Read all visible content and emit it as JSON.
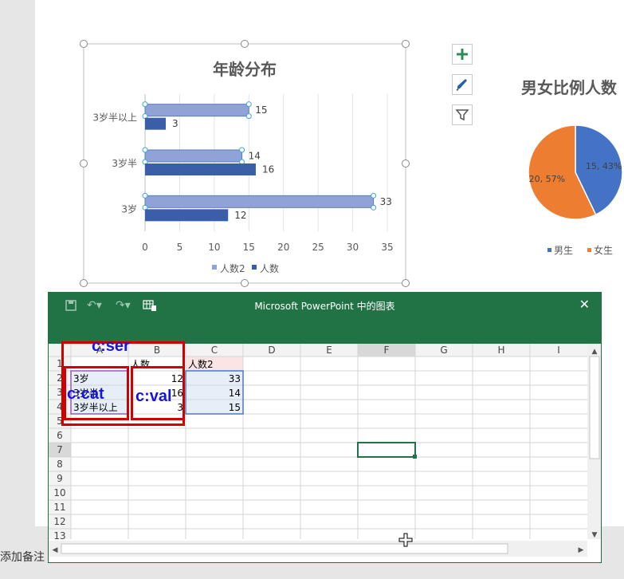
{
  "bar_chart": {
    "chart_data": {
      "type": "bar",
      "orientation": "horizontal",
      "title": "年龄分布",
      "categories": [
        "3岁",
        "3岁半",
        "3岁半以上"
      ],
      "series": [
        {
          "name": "人数2",
          "values": [
            33,
            14,
            15
          ],
          "color": "#8fa3d6"
        },
        {
          "name": "人数",
          "values": [
            12,
            16,
            3
          ],
          "color": "#3a5ea8"
        }
      ],
      "xlim": [
        0,
        35
      ],
      "xticks": [
        "0",
        "5",
        "10",
        "15",
        "20",
        "25",
        "30",
        "35"
      ],
      "grid": true,
      "legend": "bottom"
    }
  },
  "pie_chart": {
    "chart_data": {
      "type": "pie",
      "title": "男女比例人数",
      "labels": [
        "男生",
        "女生"
      ],
      "values": [
        15,
        20
      ],
      "data_labels": [
        "15, 43%",
        "20, 57%"
      ],
      "colors": [
        "#4472c4",
        "#ed7d31"
      ],
      "legend": "bottom"
    }
  },
  "chart_tools": [
    "plus-icon",
    "brush-icon",
    "filter-icon"
  ],
  "excel": {
    "window_title": "Microsoft PowerPoint 中的图表",
    "columns": [
      "A",
      "B",
      "C",
      "D",
      "E",
      "F",
      "G",
      "H",
      "I"
    ],
    "rows": [
      "1",
      "2",
      "3",
      "4",
      "5",
      "6",
      "7",
      "8",
      "9",
      "10",
      "11",
      "12",
      "13"
    ],
    "cells": {
      "B1": "人数",
      "C1": "人数2",
      "A2": "3岁",
      "B2": "12",
      "C2": "33",
      "A3": "3岁半",
      "B3": "16",
      "C3": "14",
      "A4": "3岁半以上",
      "B4": "3",
      "C4": "15"
    },
    "selected_cell": "F7"
  },
  "annotations": {
    "ser": "c:ser",
    "cat": "c:cat",
    "val": "c:val"
  },
  "notes": "添加备注"
}
